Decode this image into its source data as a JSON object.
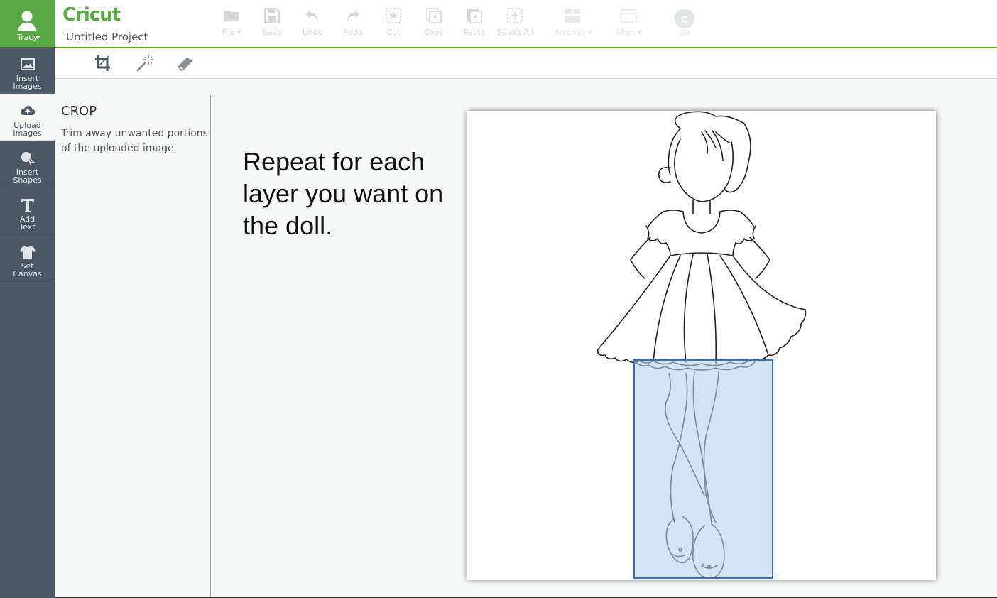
{
  "user": {
    "name": "Tracy"
  },
  "header": {
    "logo": "Cricut",
    "project_title": "Untitled Project",
    "toolbar": [
      {
        "name": "file",
        "label": "File",
        "icon": "folder-icon"
      },
      {
        "name": "save",
        "label": "Save",
        "icon": "floppy-icon"
      },
      {
        "name": "undo",
        "label": "Undo",
        "icon": "undo-icon"
      },
      {
        "name": "redo",
        "label": "Redo",
        "icon": "redo-icon"
      },
      {
        "name": "cut",
        "label": "Cut",
        "icon": "cut-icon"
      },
      {
        "name": "copy",
        "label": "Copy",
        "icon": "copy-icon"
      },
      {
        "name": "paste",
        "label": "Paste",
        "icon": "paste-icon"
      },
      {
        "name": "select-all",
        "label": "Select All",
        "icon": "select-all-icon"
      },
      {
        "name": "arrange",
        "label": "Arrange",
        "icon": "arrange-icon"
      },
      {
        "name": "align",
        "label": "Align",
        "icon": "align-icon"
      },
      {
        "name": "go",
        "label": "Go",
        "icon": "go-icon",
        "badge": "C"
      }
    ]
  },
  "rail": [
    {
      "name": "insert-images",
      "label": "Insert\nImages",
      "icon": "image-icon"
    },
    {
      "name": "upload-images",
      "label": "Upload\nImages",
      "icon": "cloud-upload-icon",
      "active": true
    },
    {
      "name": "insert-shapes",
      "label": "Insert\nShapes",
      "icon": "shapes-icon"
    },
    {
      "name": "add-text",
      "label": "Add\nText",
      "icon": "text-icon"
    },
    {
      "name": "set-canvas",
      "label": "Set\nCanvas",
      "icon": "tshirt-icon"
    }
  ],
  "tools": [
    {
      "name": "crop",
      "icon": "crop-icon"
    },
    {
      "name": "magic-wand",
      "icon": "magic-wand-icon"
    },
    {
      "name": "eraser",
      "icon": "eraser-icon"
    }
  ],
  "panel": {
    "title": "CROP",
    "description": "Trim away unwanted portions of the uploaded image."
  },
  "instruction": "Repeat for each layer you want on the doll.",
  "colors": {
    "brand": "#5aa946",
    "rail": "#4b5763",
    "crop_fill": "#b6d4ee",
    "crop_border": "#3b6ea8"
  }
}
